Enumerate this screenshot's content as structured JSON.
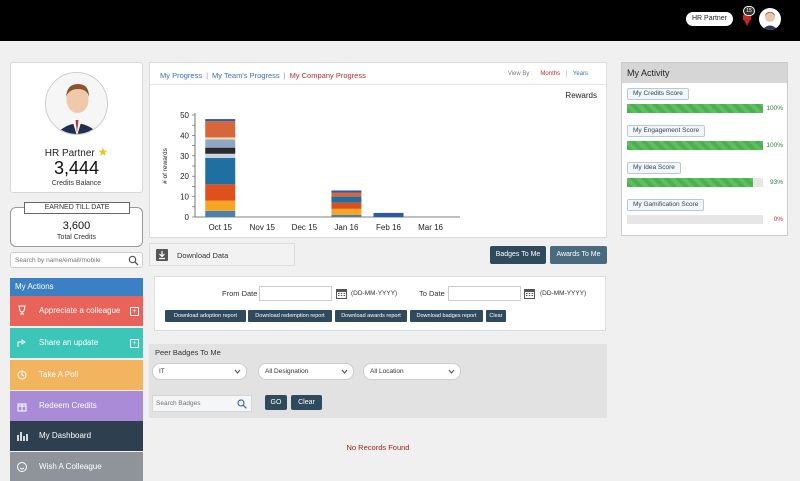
{
  "topbar": {
    "role_label": "HR Partner",
    "notification_count": "15"
  },
  "profile": {
    "name": "HR Partner",
    "credits_value": "3,444",
    "credits_label": "Credits Balance"
  },
  "earned": {
    "title": "EARNED TILL DATE",
    "value": "3,600",
    "label": "Total Credits"
  },
  "search": {
    "placeholder": "Search by name/email/mobile"
  },
  "actions": {
    "header": "My Actions",
    "items": [
      {
        "label": "Appreciate a colleague",
        "color": "#e8635a",
        "icon": "trophy-icon",
        "has_plus": true
      },
      {
        "label": "Share an update",
        "color": "#3cc6b8",
        "icon": "share-icon",
        "has_plus": true
      },
      {
        "label": "Take A Poll",
        "color": "#f2b45f",
        "icon": "poll-icon",
        "has_plus": false
      },
      {
        "label": "Redeem Credits",
        "color": "#a98bd8",
        "icon": "gift-icon",
        "has_plus": false
      },
      {
        "label": "My Dashboard",
        "color": "#2e3f4f",
        "icon": "bar-chart-icon",
        "has_plus": false
      },
      {
        "label": "Wish A Colleague",
        "color": "#8e9499",
        "icon": "smile-icon",
        "has_plus": false
      }
    ]
  },
  "tabs": {
    "items": [
      "My Progress",
      "My Team's Progress",
      "My Company Progress"
    ],
    "active": "My Company Progress"
  },
  "viewby": {
    "label": "View By :",
    "months": "Months",
    "years": "Years"
  },
  "chart_data": {
    "type": "bar",
    "stacked": true,
    "title": "Rewards",
    "xlabel": "",
    "ylabel": "# of rewards",
    "categories": [
      "Oct 15",
      "Nov 15",
      "Dec 15",
      "Jan 16",
      "Feb 16",
      "Mar 16"
    ],
    "ylim": [
      0,
      50
    ],
    "yticks": [
      0,
      5,
      10,
      15,
      20,
      25,
      30,
      35,
      40,
      45,
      50
    ],
    "grid": false,
    "series": [
      {
        "values": [
          3,
          0,
          0,
          1,
          0,
          0
        ],
        "color": "#4a7fb5"
      },
      {
        "values": [
          5,
          0,
          0,
          3,
          0,
          0
        ],
        "color": "#f5a623"
      },
      {
        "values": [
          8,
          0,
          0,
          3,
          0,
          0
        ],
        "color": "#e0501c"
      },
      {
        "values": [
          13,
          0,
          0,
          3,
          0,
          0
        ],
        "color": "#1f6fa0"
      },
      {
        "values": [
          2,
          0,
          0,
          0,
          0,
          0
        ],
        "color": "#c8d4df"
      },
      {
        "values": [
          3,
          0,
          0,
          0,
          0,
          0
        ],
        "color": "#2a2a2a"
      },
      {
        "values": [
          4,
          0,
          0,
          0,
          0,
          0
        ],
        "color": "#8fa6c4"
      },
      {
        "values": [
          1,
          0,
          0,
          0,
          0,
          0
        ],
        "color": "#e8e2b0"
      },
      {
        "values": [
          8,
          0,
          0,
          2,
          0,
          0
        ],
        "color": "#d9663a"
      },
      {
        "values": [
          1,
          0,
          0,
          1,
          2,
          0
        ],
        "color": "#2a5aa8"
      }
    ]
  },
  "download": {
    "label": "Download Data"
  },
  "buttons": {
    "badges_to_me": "Badges To Me",
    "awards_to_me": "Awards To Me"
  },
  "report": {
    "from_label": "From Date",
    "to_label": "To Date",
    "date_format": "(DD-MM-YYYY)",
    "buttons": [
      "Download adoption report",
      "Download redemption report",
      "Download awards report",
      "Download badges report",
      "Clear"
    ]
  },
  "peer": {
    "title": "Peer Badges To Me",
    "filters": [
      "IT",
      "All Designation",
      "All Location"
    ],
    "search_placeholder": "Search Badges",
    "go_label": "GO",
    "clear_label": "Clear",
    "no_records": "No Records Found"
  },
  "activity": {
    "title": "My Activity",
    "scores": [
      {
        "label": "My Credits Score",
        "percent": 100,
        "display": "100%"
      },
      {
        "label": "My Engagement Score",
        "percent": 100,
        "display": "100%"
      },
      {
        "label": "My Idea Score",
        "percent": 93,
        "display": "93%"
      },
      {
        "label": "My Gamification Score",
        "percent": 0,
        "display": "0%"
      }
    ]
  }
}
